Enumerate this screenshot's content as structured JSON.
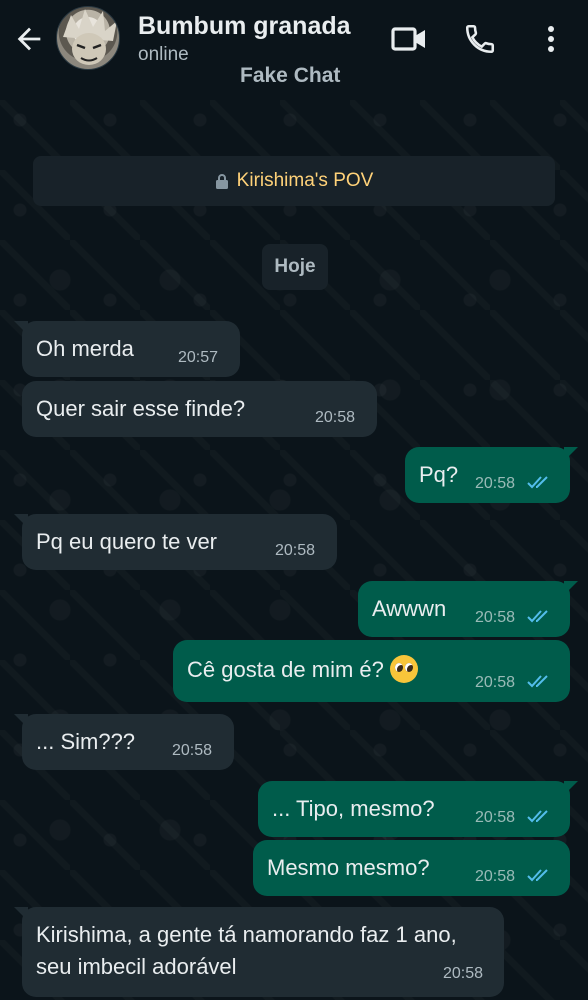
{
  "header": {
    "contact_name": "Bumbum granada",
    "status": "online",
    "overlay_label": "Fake Chat"
  },
  "banner": {
    "text": "Kirishima's POV"
  },
  "date_chip": "Hoje",
  "colors": {
    "bg": "#0b141a",
    "incoming": "#202c33",
    "outgoing": "#005c4b",
    "read_ticks": "#53bdeb",
    "banner_text": "#ffd279"
  },
  "icons": [
    "back-arrow-icon",
    "video-call-icon",
    "phone-icon",
    "more-options-icon",
    "lock-icon",
    "read-receipt-icon"
  ],
  "messages": [
    {
      "dir": "in",
      "text": "Oh merda",
      "time": "20:57"
    },
    {
      "dir": "in",
      "text": "Quer sair esse finde?",
      "time": "20:58"
    },
    {
      "dir": "out",
      "text": "Pq?",
      "time": "20:58",
      "status": "read"
    },
    {
      "dir": "in",
      "text": "Pq eu quero te ver",
      "time": "20:58"
    },
    {
      "dir": "out",
      "text": "Awwwn",
      "time": "20:58",
      "status": "read"
    },
    {
      "dir": "out",
      "text": "Cê gosta de mim é?",
      "emoji": "pleading-face",
      "time": "20:58",
      "status": "read"
    },
    {
      "dir": "in",
      "text": "... Sim???",
      "time": "20:58"
    },
    {
      "dir": "out",
      "text": "... Tipo, mesmo?",
      "time": "20:58",
      "status": "read"
    },
    {
      "dir": "out",
      "text": "Mesmo mesmo?",
      "time": "20:58",
      "status": "read"
    },
    {
      "dir": "in",
      "text": "Kirishima, a gente tá namorando faz 1 ano, seu imbecil adorável",
      "time": "20:58"
    }
  ]
}
